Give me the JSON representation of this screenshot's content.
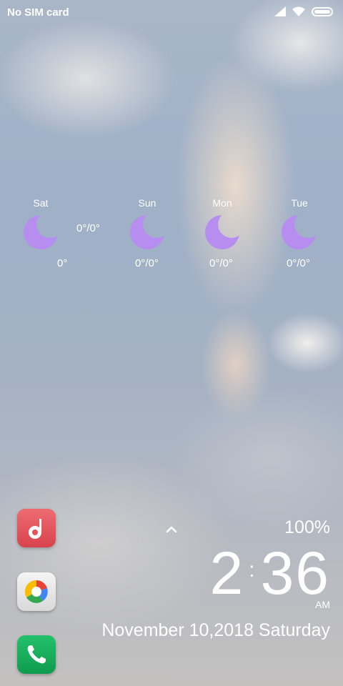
{
  "status_bar": {
    "carrier": "No SIM card",
    "icons": [
      "signal-icon",
      "wifi-icon",
      "battery-icon"
    ]
  },
  "weather": {
    "icon_color": "#b78df0",
    "days": [
      {
        "day": "Sat",
        "temp": "0°",
        "temp_extra": "0°/0°",
        "icon": "moon-icon"
      },
      {
        "day": "Sun",
        "temp": "0°/0°",
        "icon": "moon-icon"
      },
      {
        "day": "Mon",
        "temp": "0°/0°",
        "icon": "moon-icon"
      },
      {
        "day": "Tue",
        "temp": "0°/0°",
        "icon": "moon-icon"
      }
    ]
  },
  "dock": {
    "apps": [
      {
        "name": "music",
        "icon": "music-note-icon",
        "color": "#e2525a"
      },
      {
        "name": "browser",
        "icon": "browser-icon"
      },
      {
        "name": "phone",
        "icon": "phone-icon",
        "color": "#1aab5b"
      }
    ]
  },
  "lockscreen": {
    "chevron": "chevron-up-icon",
    "battery_percent": "100%",
    "hour": "2",
    "minutes": "36",
    "colon": ":",
    "ampm": "AM",
    "date": "November 10,2018 Saturday"
  }
}
